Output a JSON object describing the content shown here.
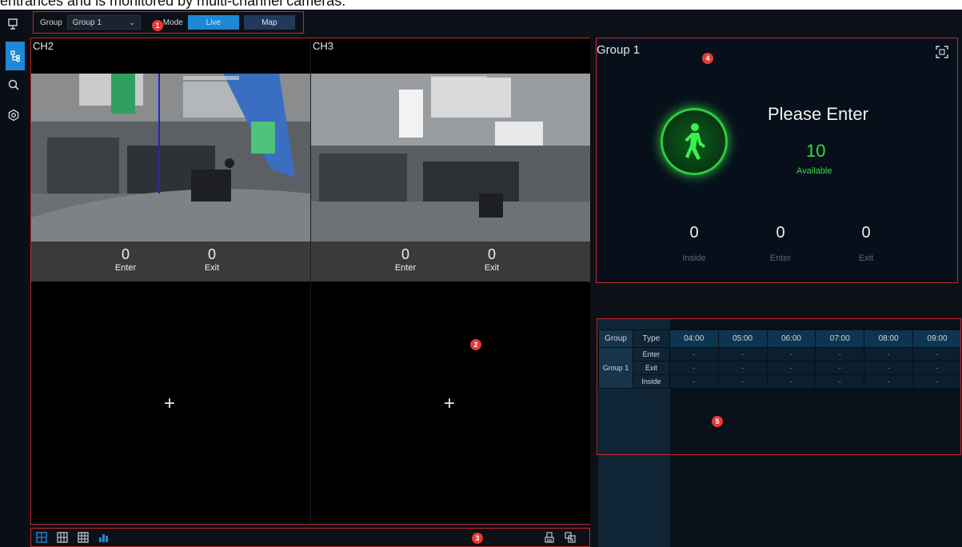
{
  "caption": "entrances and is monitored by multi-channel cameras.",
  "toolbar": {
    "group_label": "Group",
    "group_value": "Group 1",
    "mode_label": "Mode",
    "live_label": "Live",
    "map_label": "Map"
  },
  "badges": {
    "b1": "1",
    "b2": "2",
    "b3": "3",
    "b4": "4",
    "b5": "5"
  },
  "channels": [
    {
      "title": "CH2",
      "enter_count": "0",
      "enter_label": "Enter",
      "exit_count": "0",
      "exit_label": "Exit"
    },
    {
      "title": "CH3",
      "enter_count": "0",
      "enter_label": "Enter",
      "exit_count": "0",
      "exit_label": "Exit"
    }
  ],
  "empty_pane_icon": "+",
  "status_panel": {
    "title": "Group 1",
    "message": "Please Enter",
    "available_count": "10",
    "available_label": "Available",
    "inside_count": "0",
    "inside_label": "Inside",
    "enter_count": "0",
    "enter_label": "Enter",
    "exit_count": "0",
    "exit_label": "Exit"
  },
  "table": {
    "col_group": "Group",
    "col_type": "Type",
    "hours": [
      "04:00",
      "05:00",
      "06:00",
      "07:00",
      "08:00",
      "09:00"
    ],
    "group_name": "Group 1",
    "rows": [
      {
        "type": "Enter",
        "values": [
          "-",
          "-",
          "-",
          "-",
          "-",
          "-"
        ]
      },
      {
        "type": "Exit",
        "values": [
          "-",
          "-",
          "-",
          "-",
          "-",
          "-"
        ]
      },
      {
        "type": "Inside",
        "values": [
          "-",
          "-",
          "-",
          "-",
          "-",
          "-"
        ]
      }
    ]
  },
  "colors": {
    "accent": "#1e88d6",
    "annotation_red": "#c62828",
    "available_green": "#2ee03c"
  },
  "icons": {
    "rail": [
      "live-view-icon",
      "people-count-icon",
      "search-icon",
      "settings-icon"
    ],
    "bottom_left": [
      "grid-1x1-icon",
      "grid-2x2-icon",
      "grid-3x3-icon",
      "bar-chart-icon"
    ],
    "bottom_right": [
      "clear-icon",
      "export-icon"
    ]
  }
}
